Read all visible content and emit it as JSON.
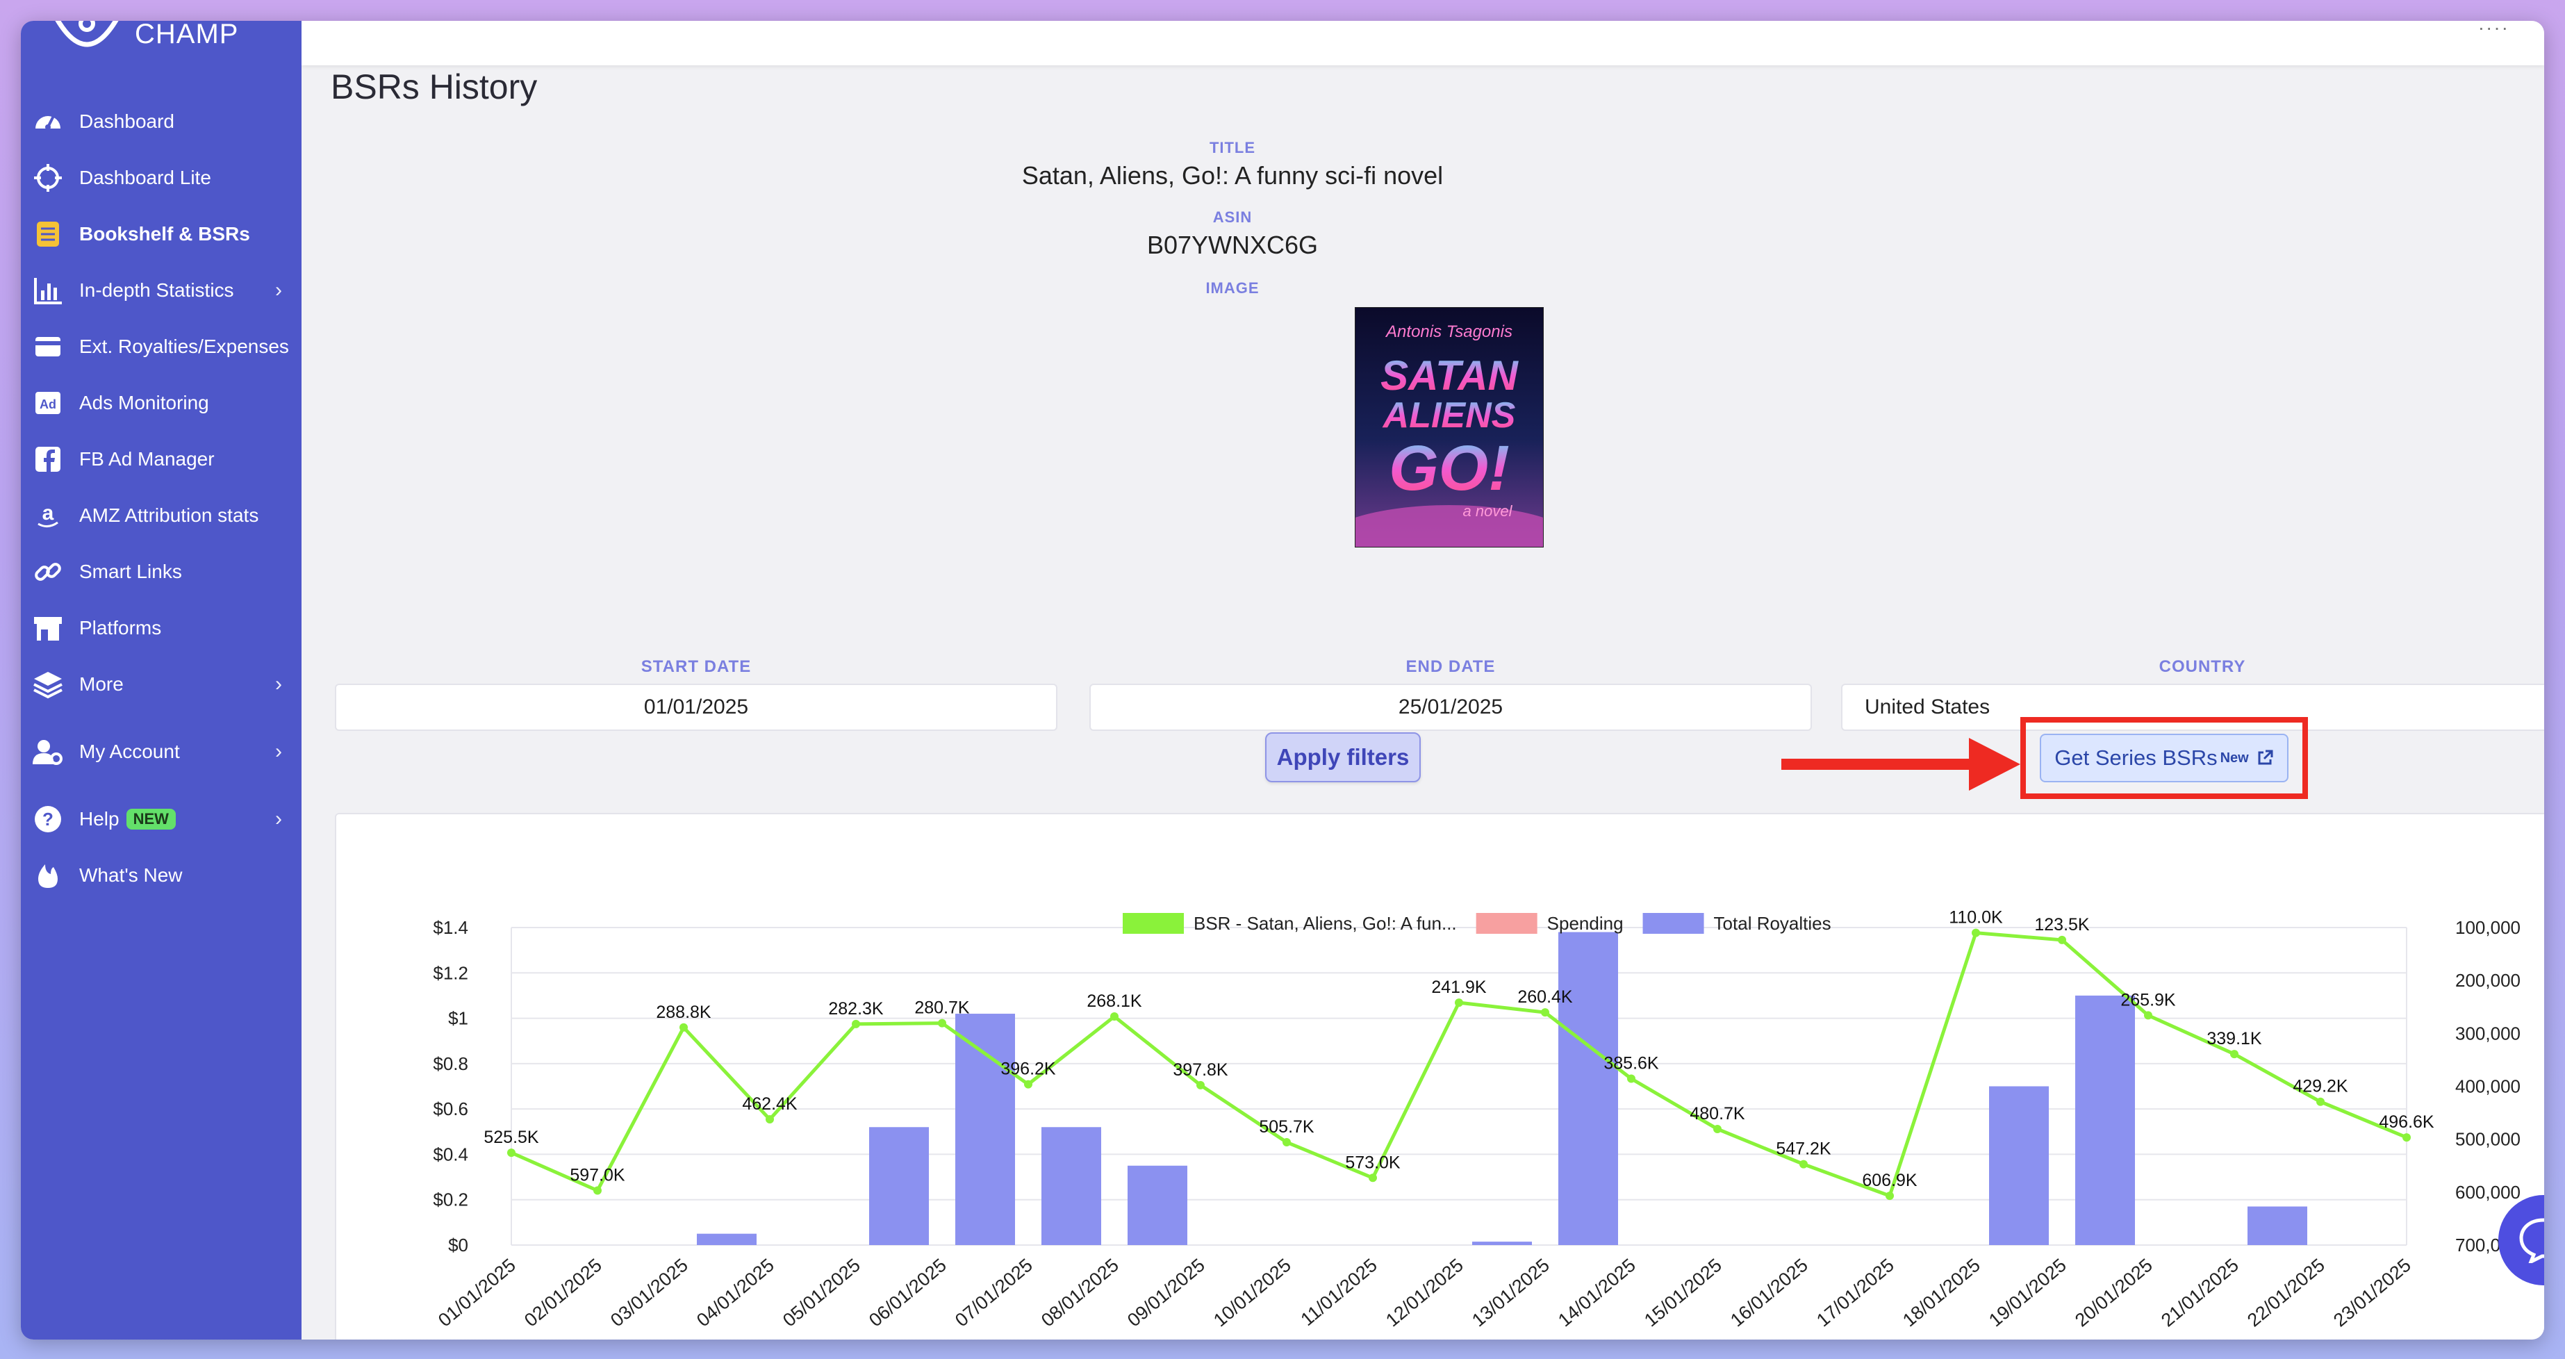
{
  "app": {
    "brand": "CHAMP",
    "page_title": "BSRs History"
  },
  "sidebar": {
    "items": [
      {
        "label": "Dashboard",
        "icon": "gauge-icon"
      },
      {
        "label": "Dashboard Lite",
        "icon": "crosshair-icon"
      },
      {
        "label": "Bookshelf & BSRs",
        "icon": "bookshelf-icon",
        "active": true
      },
      {
        "label": "In-depth Statistics",
        "icon": "bar-chart-icon",
        "has_submenu": true
      },
      {
        "label": "Ext. Royalties/Expenses",
        "icon": "wallet-icon"
      },
      {
        "label": "Ads Monitoring",
        "icon": "ad-icon"
      },
      {
        "label": "FB Ad Manager",
        "icon": "facebook-icon"
      },
      {
        "label": "AMZ Attribution stats",
        "icon": "amazon-icon"
      },
      {
        "label": "Smart Links",
        "icon": "link-icon"
      },
      {
        "label": "Platforms",
        "icon": "store-icon"
      },
      {
        "label": "More",
        "icon": "layers-icon",
        "has_submenu": true
      },
      {
        "label": "My Account",
        "icon": "user-gear-icon",
        "has_submenu": true
      },
      {
        "label": "Help",
        "icon": "question-icon",
        "has_submenu": true,
        "badge": "NEW"
      },
      {
        "label": "What's New",
        "icon": "flame-icon"
      }
    ]
  },
  "book": {
    "title_label": "TITLE",
    "title": "Satan, Aliens, Go!: A funny sci-fi novel",
    "asin_label": "ASIN",
    "asin": "B07YWNXC6G",
    "image_label": "IMAGE",
    "cover": {
      "author": "Antonis Tsagonis",
      "line1": "SATAN",
      "line2": "ALIENS",
      "line3": "GO!",
      "tagline": "a novel"
    }
  },
  "filters": {
    "start_label": "START DATE",
    "start_value": "01/01/2025",
    "end_label": "END DATE",
    "end_value": "25/01/2025",
    "country_label": "COUNTRY",
    "country_value": "United States",
    "apply_label": "Apply filters",
    "series_label": "Get Series BSRs",
    "series_badge": "New"
  },
  "colors": {
    "sidebar": "#4e57c9",
    "bsr_line": "#8af23a",
    "spending": "#f7a0a0",
    "royalties": "#8b91f0",
    "highlight": "#ee2a22"
  },
  "chart_data": {
    "type": "bar",
    "legend": [
      "BSR - Satan, Aliens, Go!: A fun...",
      "Spending",
      "Total Royalties"
    ],
    "legend_position": "top-center",
    "categories": [
      "01/01/2025",
      "02/01/2025",
      "03/01/2025",
      "04/01/2025",
      "05/01/2025",
      "06/01/2025",
      "07/01/2025",
      "08/01/2025",
      "09/01/2025",
      "10/01/2025",
      "11/01/2025",
      "12/01/2025",
      "13/01/2025",
      "14/01/2025",
      "15/01/2025",
      "16/01/2025",
      "17/01/2025",
      "18/01/2025",
      "19/01/2025",
      "20/01/2025",
      "21/01/2025",
      "22/01/2025",
      "23/01/2025"
    ],
    "left_ticks": [
      "$0",
      "$0.2",
      "$0.4",
      "$0.6",
      "$0.8",
      "$1",
      "$1.2",
      "$1.4"
    ],
    "left_ylim": [
      0,
      1.4
    ],
    "right_ticks": [
      "100,000",
      "200,000",
      "300,000",
      "400,000",
      "500,000",
      "600,000",
      "700,000"
    ],
    "right_ylim": [
      100000,
      700000
    ],
    "right_reversed": true,
    "series": [
      {
        "name": "Total Royalties",
        "kind": "bar",
        "axis": "left",
        "values": [
          0,
          0,
          0.05,
          0,
          0.52,
          1.02,
          0.52,
          0.35,
          0,
          0,
          0,
          0.015,
          1.38,
          0,
          0,
          0,
          0,
          0.7,
          1.1,
          0,
          0.17,
          0,
          0
        ]
      },
      {
        "name": "Spending",
        "kind": "bar",
        "axis": "left",
        "values": [
          0,
          0,
          0,
          0,
          0,
          0,
          0,
          0,
          0,
          0,
          0,
          0,
          0,
          0,
          0,
          0,
          0,
          0,
          0,
          0,
          0,
          0,
          0
        ]
      },
      {
        "name": "BSR - Satan, Aliens, Go!: A fun...",
        "kind": "line",
        "axis": "right",
        "values": [
          525500,
          597000,
          288800,
          462400,
          282300,
          280700,
          396200,
          268100,
          397800,
          505700,
          573000,
          241900,
          260400,
          385600,
          480700,
          547200,
          606900,
          110000,
          123500,
          265900,
          339100,
          429200,
          496600
        ],
        "labels": [
          "525.5K",
          "597.0K",
          "288.8K",
          "462.4K",
          "282.3K",
          "280.7K",
          "396.2K",
          "268.1K",
          "397.8K",
          "505.7K",
          "573.0K",
          "241.9K",
          "260.4K",
          "385.6K",
          "480.7K",
          "547.2K",
          "606.9K",
          "110.0K",
          "123.5K",
          "265.9K",
          "339.1K",
          "429.2K",
          "496.6K"
        ]
      }
    ]
  }
}
